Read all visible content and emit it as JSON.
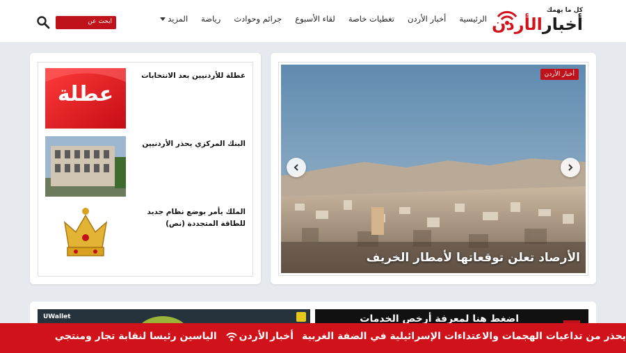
{
  "header": {
    "logo_tagline": "كل ما يهمك",
    "logo_part1": "أخبار",
    "logo_part2": "الأردن",
    "nav": [
      {
        "label": "الرئيسية"
      },
      {
        "label": "أخبار الأردن"
      },
      {
        "label": "تغطيات خاصة"
      },
      {
        "label": "لقاء الأسبوع"
      },
      {
        "label": "جرائم وحوادث"
      },
      {
        "label": "رياضة"
      },
      {
        "label": "المزيد"
      }
    ],
    "search_label": "ابحث عن"
  },
  "slider": {
    "badge": "أخبار الأردن",
    "title": "الأرصاد تعلن توقعاتها لأمطار الخريف"
  },
  "side_list": [
    {
      "title": "عطلة للأردنيين بعد الانتخابات",
      "thumb_text": "عطلة"
    },
    {
      "title": "البنك المركزي يحذر الأردنيين"
    },
    {
      "title": "الملك يأمر بوضع نظام جديد للطاقة المتجددة (نص)"
    }
  ],
  "ads": {
    "left_brand": "UWallet",
    "right_text": "اضغط هنا لمعرفة أرخص الخدمات"
  },
  "ticker": {
    "item1": "يحذر من تداعيات الهجمات والاعتداءات الإسرائيلية في الضفة الغربية",
    "logo1": "أخبار",
    "logo2": "الأردن",
    "item2": "الياسين رئيسا لنقابة تجار ومنتجي"
  },
  "colors": {
    "brand_red": "#d0121b",
    "text": "#222222"
  }
}
